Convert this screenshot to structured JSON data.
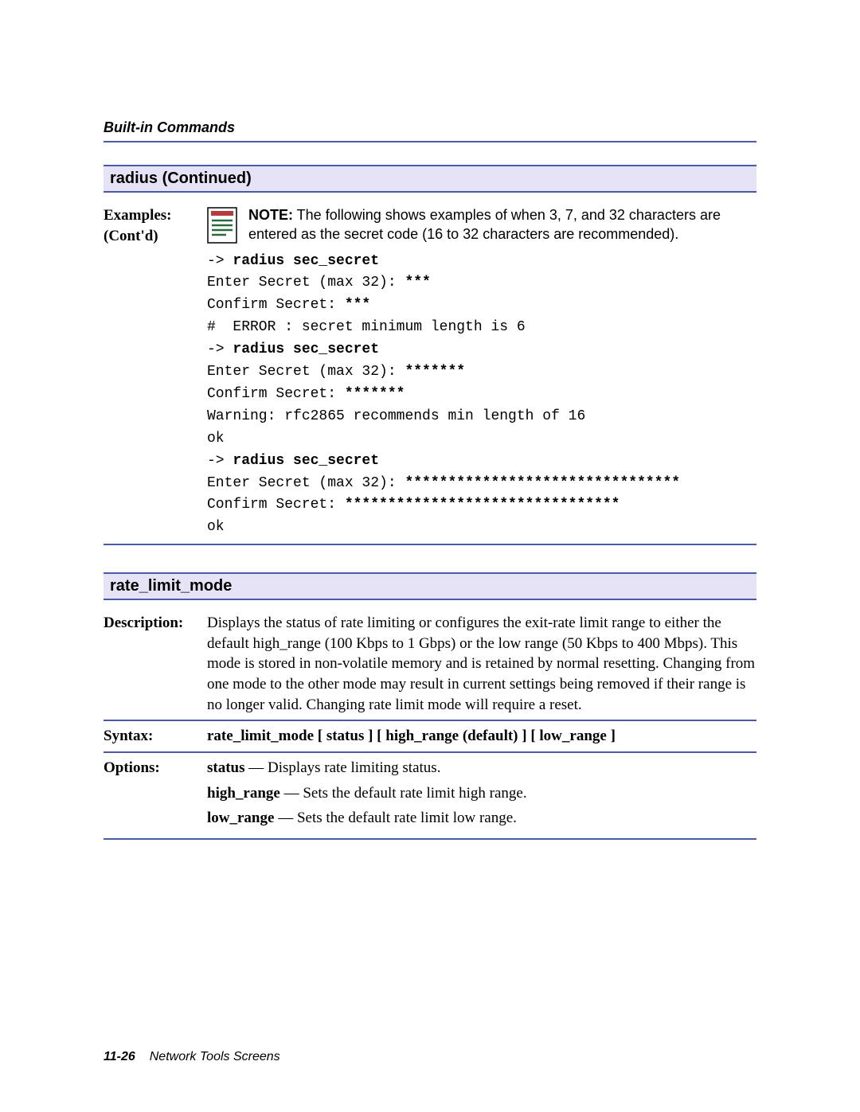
{
  "header": {
    "running_head": "Built-in Commands"
  },
  "section1": {
    "title": "radius (Continued)",
    "label_line1": "Examples:",
    "label_line2": "(Cont'd)",
    "note_prefix": "NOTE:",
    "note_body": " The following shows examples of when 3, 7, and 32 characters are entered as the secret code (16 to 32 characters are recommended).",
    "code": {
      "l01a": "-> ",
      "l01b": "radius sec_secret",
      "l02a": "Enter Secret (max 32): ",
      "l02b": "***",
      "l03a": "Confirm Secret: ",
      "l03b": "***",
      "l04": "#  ERROR : secret minimum length is 6",
      "l05a": "-> ",
      "l05b": "radius sec_secret",
      "l06a": "Enter Secret (max 32): ",
      "l06b": "*******",
      "l07a": "Confirm Secret: ",
      "l07b": "*******",
      "l08": "Warning: rfc2865 recommends min length of 16",
      "l09": "ok",
      "l10a": "-> ",
      "l10b": "radius sec_secret",
      "l11a": "Enter Secret (max 32): ",
      "l11b": "********************************",
      "l12a": "Confirm Secret: ",
      "l12b": "********************************",
      "l13": "ok"
    }
  },
  "section2": {
    "title": "rate_limit_mode",
    "rows": {
      "description_label": "Description:",
      "description_body": "Displays the status of rate limiting or configures the exit-rate limit range to either the default high_range (100 Kbps to 1 Gbps) or the low range (50 Kbps to 400 Mbps). This mode is stored in non-volatile memory and is retained by normal resetting. Changing from one mode to the other mode may result in current settings being removed if their range is no longer valid. Changing rate limit mode will require a reset.",
      "syntax_label": "Syntax:",
      "syntax_body": "rate_limit_mode [ status ] [ high_range (default) ] [ low_range ]",
      "options_label": "Options:",
      "options": [
        {
          "key": "status",
          "text": " — Displays rate limiting status."
        },
        {
          "key": "high_range",
          "text": " — Sets the default rate limit high range."
        },
        {
          "key": "low_range",
          "text": " — Sets the default rate limit low range."
        }
      ]
    }
  },
  "footer": {
    "page": "11-26",
    "title": "Network Tools Screens"
  }
}
